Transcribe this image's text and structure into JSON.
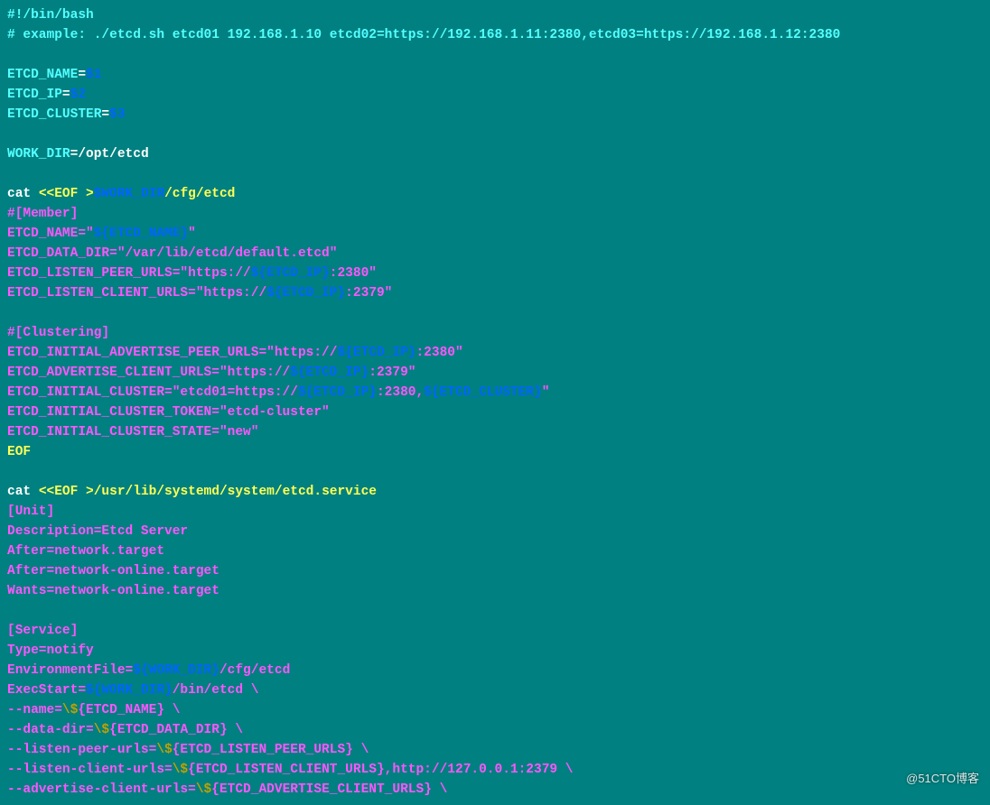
{
  "code": {
    "l1_shebang": "#!/bin/bash",
    "l2_comment": "# example: ./etcd.sh etcd01 192.168.1.10 etcd02=https://192.168.1.11:2380,etcd03=https://192.168.1.12:2380",
    "l3_blank": "",
    "l4_a": "ETCD_NAME",
    "l4_eq": "=",
    "l4_b": "$1",
    "l5_a": "ETCD_IP",
    "l5_eq": "=",
    "l5_b": "$2",
    "l6_a": "ETCD_CLUSTER",
    "l6_eq": "=",
    "l6_b": "$3",
    "l7_blank": "",
    "l8_a": "WORK_DIR",
    "l8_eq": "=",
    "l8_b": "/opt/etcd",
    "l9_blank": "",
    "l10_a": "cat ",
    "l10_b": "<<EOF >",
    "l10_c": "$WORK_DIR",
    "l10_d": "/cfg/etcd",
    "l11": "#[Member]",
    "l12_a": "ETCD_NAME=\"",
    "l12_b": "${ETCD_NAME}",
    "l12_c": "\"",
    "l13": "ETCD_DATA_DIR=\"/var/lib/etcd/default.etcd\"",
    "l14_a": "ETCD_LISTEN_PEER_URLS=\"https://",
    "l14_b": "${ETCD_IP}",
    "l14_c": ":2380\"",
    "l15_a": "ETCD_LISTEN_CLIENT_URLS=\"https://",
    "l15_b": "${ETCD_IP}",
    "l15_c": ":2379\"",
    "l16_blank": "",
    "l17": "#[Clustering]",
    "l18_a": "ETCD_INITIAL_ADVERTISE_PEER_URLS=\"https://",
    "l18_b": "${ETCD_IP}",
    "l18_c": ":2380\"",
    "l19_a": "ETCD_ADVERTISE_CLIENT_URLS=\"https://",
    "l19_b": "${ETCD_IP}",
    "l19_c": ":2379\"",
    "l20_a": "ETCD_INITIAL_CLUSTER=\"etcd01=https://",
    "l20_b": "${ETCD_IP}",
    "l20_c": ":2380,",
    "l20_d": "${ETCD_CLUSTER}",
    "l20_e": "\"",
    "l21": "ETCD_INITIAL_CLUSTER_TOKEN=\"etcd-cluster\"",
    "l22": "ETCD_INITIAL_CLUSTER_STATE=\"new\"",
    "l23": "EOF",
    "l24_blank": "",
    "l25_a": "cat ",
    "l25_b": "<<EOF >",
    "l25_c": "/usr/lib/systemd/system/etcd.service",
    "l26": "[Unit]",
    "l27": "Description=Etcd Server",
    "l28": "After=network.target",
    "l29": "After=network-online.target",
    "l30": "Wants=network-online.target",
    "l31_blank": "",
    "l32": "[Service]",
    "l33": "Type=notify",
    "l34_a": "EnvironmentFile=",
    "l34_b": "${WORK_DIR}",
    "l34_c": "/cfg/etcd",
    "l35_a": "ExecStart=",
    "l35_b": "${WORK_DIR}",
    "l35_c": "/bin/etcd \\",
    "l36_a": "--name=",
    "l36_b": "\\$",
    "l36_c": "{ETCD_NAME} \\",
    "l37_a": "--data-dir=",
    "l37_b": "\\$",
    "l37_c": "{ETCD_DATA_DIR} \\",
    "l38_a": "--listen-peer-urls=",
    "l38_b": "\\$",
    "l38_c": "{ETCD_LISTEN_PEER_URLS} \\",
    "l39_a": "--listen-client-urls=",
    "l39_b": "\\$",
    "l39_c": "{ETCD_LISTEN_CLIENT_URLS},http://127.0.0.1:2379 \\",
    "l40_a": "--advertise-client-urls=",
    "l40_b": "\\$",
    "l40_c": "{ETCD_ADVERTISE_CLIENT_URLS} \\"
  },
  "watermark": "@51CTO博客"
}
